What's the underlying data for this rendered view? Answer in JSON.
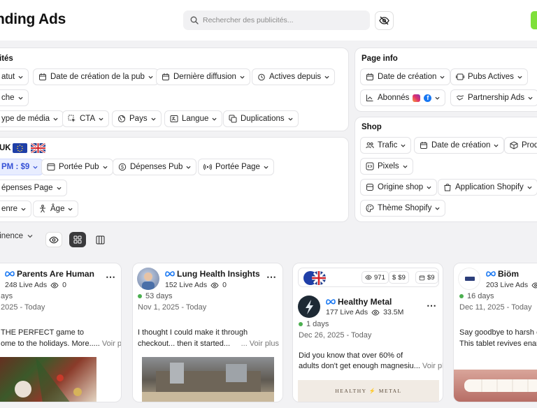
{
  "header": {
    "title": "nding Ads",
    "search_placeholder": "Rechercher des publicités...",
    "colors": {
      "accent_green": "#7fe03a",
      "blue_chip": "#3551d6"
    }
  },
  "filters_panel": {
    "title": "ités",
    "row1": [
      "atut",
      "Date de création de la pub",
      "Dernière diffusion",
      "Actives depuis"
    ],
    "row2": [
      "che"
    ],
    "row3": [
      "ype de média",
      "CTA",
      "Pays",
      "Langue",
      "Duplications"
    ]
  },
  "region_panel": {
    "label": "UK",
    "row1": [
      "PM : $9",
      "Portée Pub",
      "Dépenses Pub",
      "Portée Page"
    ],
    "row2": [
      "épenses Page"
    ],
    "row3": [
      "enre",
      "Âge"
    ]
  },
  "page_info": {
    "title": "Page info",
    "row1": [
      "Date de création",
      "Pubs Actives"
    ],
    "row2": [
      "Abonnés",
      "Partnership Ads"
    ]
  },
  "shop": {
    "title": "Shop",
    "row1": [
      "Trafic",
      "Date de création",
      "Prod"
    ],
    "row2": [
      "Pixels"
    ],
    "row3": [
      "Origine shop",
      "Application Shopify"
    ],
    "row4": [
      "Thème Shopify"
    ]
  },
  "toolbar": {
    "sort_label": "tinence"
  },
  "cards": [
    {
      "name": "Parents Are Human",
      "live_ads": "248 Live Ads",
      "views": "0",
      "days": "ays",
      "date": "2025 - Today",
      "text1": "THE PERFECT game to",
      "text2": "ome to the holidays. More.....",
      "voir": "Voir plus"
    },
    {
      "name": "Lung Health Insights",
      "live_ads": "152 Live Ads",
      "views": "0",
      "days": "53 days",
      "date": "Nov 1, 2025 - Today",
      "text1": "I thought I could make it through",
      "text2": "checkout... then it started...",
      "voir": "... Voir plus"
    },
    {
      "name": "Healthy Metal",
      "live_ads": "177 Live Ads",
      "views": "33.5M",
      "stat_views": "971",
      "stat_spend": "$9",
      "stat_cpm": "$9",
      "days": "1 days",
      "date": "Dec 26, 2025 - Today",
      "text1": "Did you know that over 60% of",
      "text2": "adults don't get enough magnesiu...",
      "voir": "Voir plus",
      "thumb_text": "HEALTHY ⚡ METAL"
    },
    {
      "name": "Biöm",
      "live_ads": "203 Live Ads",
      "days": "16 days",
      "date": "Dec 11, 2025 - Today",
      "text1": "Say goodbye to harsh che",
      "text2": "This tablet revives ename"
    }
  ]
}
